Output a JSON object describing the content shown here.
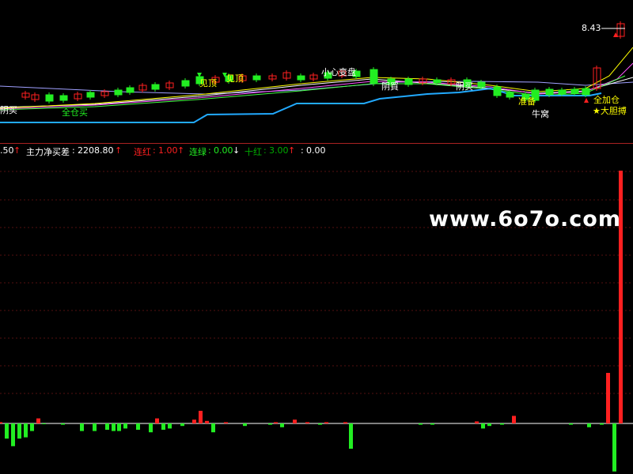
{
  "colors": {
    "background": "#000000",
    "up": "#ff2020",
    "down": "#22ee22",
    "line_cyan": "#22aaff",
    "text_white": "#ffffff",
    "text_yellow": "#ffff00",
    "text_green": "#00ff00",
    "grid": "#551111"
  },
  "price_panel": {
    "price_label": "8.43",
    "annotations": [
      {
        "text": "阴买"
      },
      {
        "text": "全仓买"
      },
      {
        "text": "见顶"
      },
      {
        "text": "见顶"
      },
      {
        "text": "小心变盘"
      },
      {
        "text": "阴買"
      },
      {
        "text": "阴买"
      },
      {
        "text": "准备"
      },
      {
        "text": "牛窝"
      },
      {
        "text": "全加仓"
      },
      {
        "text": "★大胆搏"
      }
    ]
  },
  "indicator_bar": {
    "partial": ".50",
    "net_label": "主力净买差",
    "net_value": "2208.80",
    "lianhong_label": "连红",
    "lianhong_value": "1.00",
    "lianlv_label": "连绿",
    "lianlv_value": "0.00",
    "shihong_label": "十红",
    "shihong_value": "3.00",
    "last_value": "0.00"
  },
  "watermark": "www.6o7o.com",
  "chart_data": {
    "type": "bar",
    "title": "",
    "values": [
      0.05,
      -0.6,
      -0.9,
      -0.6,
      -0.55,
      -0.3,
      0.2,
      -0.03,
      0,
      0,
      -0.05,
      0,
      0,
      -0.3,
      0,
      -0.3,
      0,
      -0.25,
      -0.3,
      -0.3,
      -0.2,
      0,
      -0.25,
      0,
      -0.35,
      0.2,
      -0.25,
      -0.2,
      0,
      -0.1,
      0,
      0.15,
      0.5,
      0.1,
      -0.35,
      0,
      0.05,
      0,
      0,
      -0.1,
      0,
      0,
      0,
      -0.05,
      0.05,
      -0.15,
      0,
      0.15,
      0,
      0.05,
      0,
      -0.05,
      0.05,
      0,
      0,
      0.05,
      -1.0,
      0,
      0,
      0,
      0,
      0,
      0,
      0,
      0,
      0,
      0,
      -0.05,
      0,
      -0.05,
      0,
      0,
      0,
      0,
      0,
      0,
      0.08,
      -0.2,
      -0.1,
      0,
      -0.05,
      0,
      0.3,
      0,
      0,
      0,
      0,
      0,
      0,
      0,
      0,
      -0.05,
      0,
      0,
      -0.15,
      0,
      -0.05,
      2.0,
      -1.9,
      10.0
    ],
    "ylim": [
      -2,
      10.5
    ]
  }
}
